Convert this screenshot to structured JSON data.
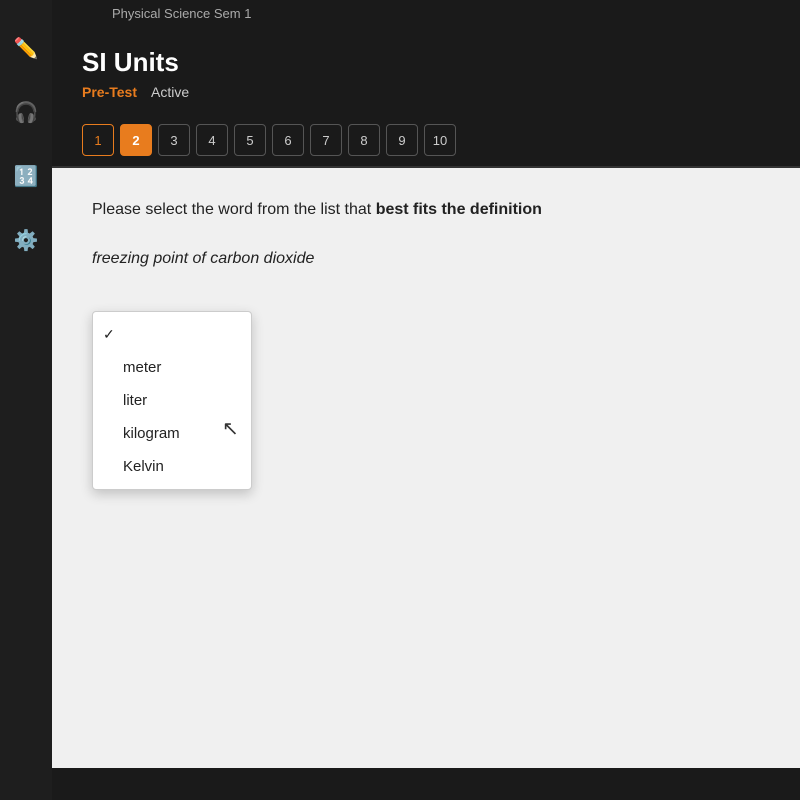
{
  "topbar": {
    "course": "Physical Science Sem 1"
  },
  "sidebar": {
    "icons": [
      {
        "name": "pencil-icon",
        "symbol": "✏️"
      },
      {
        "name": "headphones-icon",
        "symbol": "🎧"
      },
      {
        "name": "calculator-icon",
        "symbol": "🔢"
      },
      {
        "name": "settings-icon",
        "symbol": "⚙️"
      }
    ]
  },
  "header": {
    "title": "SI Units",
    "breadcrumb_pretest": "Pre-Test",
    "breadcrumb_active": "Active"
  },
  "question_nav": {
    "numbers": [
      1,
      2,
      3,
      4,
      5,
      6,
      7,
      8,
      9,
      10
    ],
    "current": 2,
    "visited": [
      1
    ]
  },
  "question": {
    "instruction": "Please select the word from the list that best fits the definition",
    "instruction_bold": "best fits the definition",
    "definition": "freezing point of carbon dioxide"
  },
  "dropdown": {
    "placeholder": "",
    "options": [
      {
        "value": "meter",
        "label": "meter",
        "checked": false
      },
      {
        "value": "liter",
        "label": "liter",
        "checked": false
      },
      {
        "value": "kilogram",
        "label": "kilogram",
        "checked": false
      },
      {
        "value": "Kelvin",
        "label": "Kelvin",
        "checked": false
      }
    ],
    "selected_empty": true
  }
}
